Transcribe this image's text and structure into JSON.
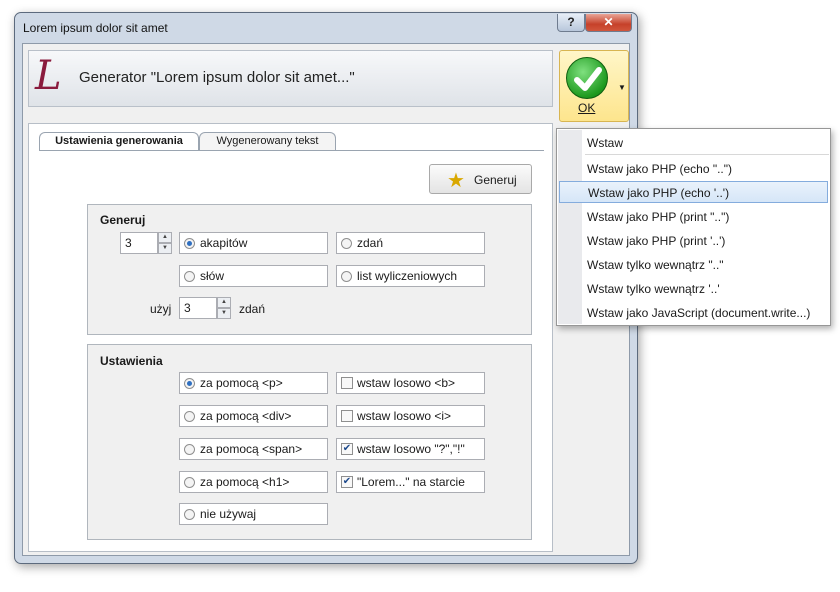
{
  "window": {
    "title": "Lorem ipsum dolor sit amet",
    "help_label": "?",
    "close_label": "✕"
  },
  "header": {
    "logo_letter": "L",
    "title": "Generator \"Lorem ipsum dolor sit amet...\""
  },
  "ok_button": {
    "label": "OK",
    "arrow": "▼"
  },
  "tabs": [
    {
      "label": "Ustawienia generowania",
      "active": true
    },
    {
      "label": "Wygenerowany tekst",
      "active": false
    }
  ],
  "generate_button": {
    "label": "Generuj",
    "icon": "magic-wand-icon"
  },
  "generuj_group": {
    "title": "Generuj",
    "count_value": "3",
    "options": [
      {
        "label": "akapitów",
        "selected": true
      },
      {
        "label": "zdań",
        "selected": false
      },
      {
        "label": "słów",
        "selected": false
      },
      {
        "label": "list wyliczeniowych",
        "selected": false
      }
    ],
    "use_label": "użyj",
    "use_value": "3",
    "use_unit": "zdań"
  },
  "ustawienia_group": {
    "title": "Ustawienia",
    "radios": [
      {
        "label": "za pomocą <p>",
        "selected": true
      },
      {
        "label": "za pomocą <div>",
        "selected": false
      },
      {
        "label": "za pomocą <span>",
        "selected": false
      },
      {
        "label": "za pomocą <h1>",
        "selected": false
      },
      {
        "label": "nie używaj",
        "selected": false
      }
    ],
    "checks": [
      {
        "label": "wstaw losowo <b>",
        "checked": false
      },
      {
        "label": "wstaw losowo <i>",
        "checked": false
      },
      {
        "label": "wstaw losowo \"?\",\"!\"",
        "checked": true
      },
      {
        "label": "\"Lorem...\" na starcie",
        "checked": true
      }
    ]
  },
  "menu": {
    "items": [
      {
        "label": "Wstaw"
      },
      {
        "label": "Wstaw jako PHP (echo \"..\")"
      },
      {
        "label": "Wstaw jako PHP (echo '..')",
        "highlighted": true
      },
      {
        "label": "Wstaw jako PHP (print \"..\")"
      },
      {
        "label": "Wstaw jako PHP (print '..')"
      },
      {
        "label": "Wstaw tylko wewnątrz \"..\""
      },
      {
        "label": "Wstaw tylko wewnątrz '..'"
      },
      {
        "label": "Wstaw jako JavaScript (document.write...)"
      }
    ]
  }
}
